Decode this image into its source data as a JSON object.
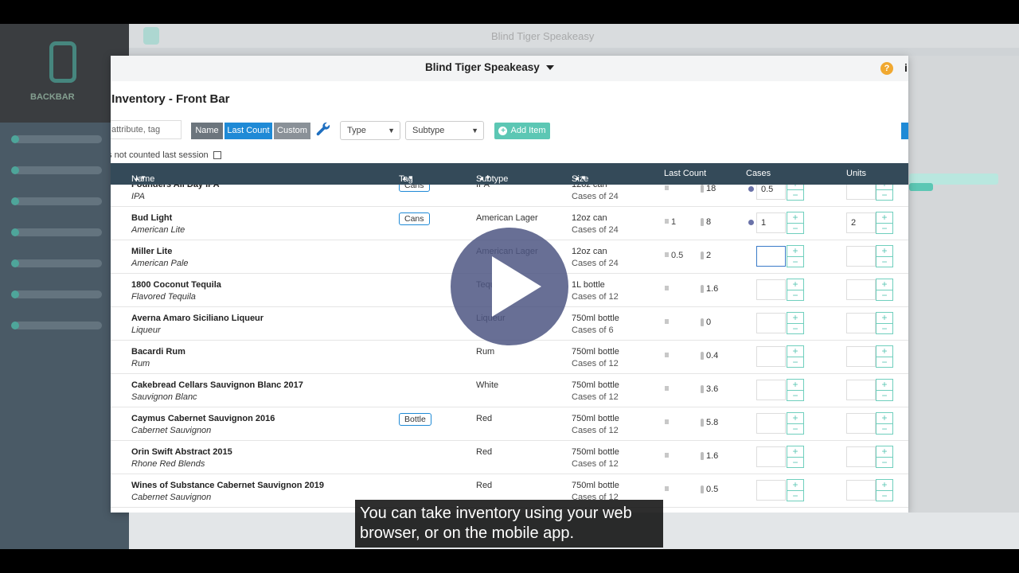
{
  "background": {
    "app_title": "Blind Tiger Speakeasy",
    "logo_text": "BACKBAR"
  },
  "header": {
    "venue": "Blind Tiger Speakeasy",
    "help": "?",
    "info": "i"
  },
  "page_title": "t Inventory - Front Bar",
  "search": {
    "placeholder": "attribute, tag"
  },
  "toggles": {
    "name": "Name",
    "last_count": "Last Count",
    "custom": "Custom"
  },
  "filters": {
    "type": "Type",
    "subtype": "Subtype"
  },
  "add_item": "Add Item",
  "filter_note": "'s not counted last session",
  "columns": {
    "name": "Name",
    "tag": "Tag",
    "subtype": "Subtype",
    "size": "Size",
    "last_count": "Last Count",
    "cases": "Cases",
    "units": "Units"
  },
  "rows": [
    {
      "name": "Founders All Day IPA",
      "category": "IPA",
      "tag": "Cans",
      "subtype": "IPA",
      "size": "12oz can",
      "cases_of": "Cases of 24",
      "last_cases": "",
      "last_units": "18",
      "cases_value": "0.5",
      "units_value": "",
      "dot": true
    },
    {
      "name": "Bud Light",
      "category": "American Lite",
      "tag": "Cans",
      "subtype": "American Lager",
      "size": "12oz can",
      "cases_of": "Cases of 24",
      "last_cases": "1",
      "last_units": "8",
      "cases_value": "1",
      "units_value": "2",
      "dot": true
    },
    {
      "name": "Miller Lite",
      "category": "American Pale",
      "tag": "",
      "subtype": "American Lager",
      "size": "12oz can",
      "cases_of": "Cases of 24",
      "last_cases": "0.5",
      "last_units": "2",
      "cases_value": "",
      "units_value": "",
      "dot": false
    },
    {
      "name": "1800 Coconut Tequila",
      "category": "Flavored Tequila",
      "tag": "",
      "subtype": "Tequila",
      "size": "1L bottle",
      "cases_of": "Cases of 12",
      "last_cases": "",
      "last_units": "1.6",
      "cases_value": "",
      "units_value": "",
      "dot": false
    },
    {
      "name": "Averna Amaro Siciliano Liqueur",
      "category": "Liqueur",
      "tag": "",
      "subtype": "Liqueur",
      "size": "750ml bottle",
      "cases_of": "Cases of 6",
      "last_cases": "",
      "last_units": "0",
      "cases_value": "",
      "units_value": "",
      "dot": false
    },
    {
      "name": "Bacardi Rum",
      "category": "Rum",
      "tag": "",
      "subtype": "Rum",
      "size": "750ml bottle",
      "cases_of": "Cases of 12",
      "last_cases": "",
      "last_units": "0.4",
      "cases_value": "",
      "units_value": "",
      "dot": false
    },
    {
      "name": "Cakebread Cellars Sauvignon Blanc 2017",
      "category": "Sauvignon Blanc",
      "tag": "",
      "subtype": "White",
      "size": "750ml bottle",
      "cases_of": "Cases of 12",
      "last_cases": "",
      "last_units": "3.6",
      "cases_value": "",
      "units_value": "",
      "dot": false
    },
    {
      "name": "Caymus Cabernet Sauvignon 2016",
      "category": "Cabernet Sauvignon",
      "tag": "Bottle",
      "subtype": "Red",
      "size": "750ml bottle",
      "cases_of": "Cases of 12",
      "last_cases": "",
      "last_units": "5.8",
      "cases_value": "",
      "units_value": "",
      "dot": false
    },
    {
      "name": "Orin Swift Abstract 2015",
      "category": "Rhone Red Blends",
      "tag": "",
      "subtype": "Red",
      "size": "750ml bottle",
      "cases_of": "Cases of 12",
      "last_cases": "",
      "last_units": "1.6",
      "cases_value": "",
      "units_value": "",
      "dot": false
    },
    {
      "name": "Wines of Substance Cabernet Sauvignon 2019",
      "category": "Cabernet Sauvignon",
      "tag": "",
      "subtype": "Red",
      "size": "750ml bottle",
      "cases_of": "Cases of 12",
      "last_cases": "",
      "last_units": "0.5",
      "cases_value": "",
      "units_value": "",
      "dot": false
    }
  ],
  "caption": "You can take inventory using your web browser, or on the mobile app.",
  "colors": {
    "header_bg": "#344a59",
    "accent_teal": "#5cc7b4",
    "accent_blue": "#1f8ad6",
    "play_button": "#4e5682"
  }
}
